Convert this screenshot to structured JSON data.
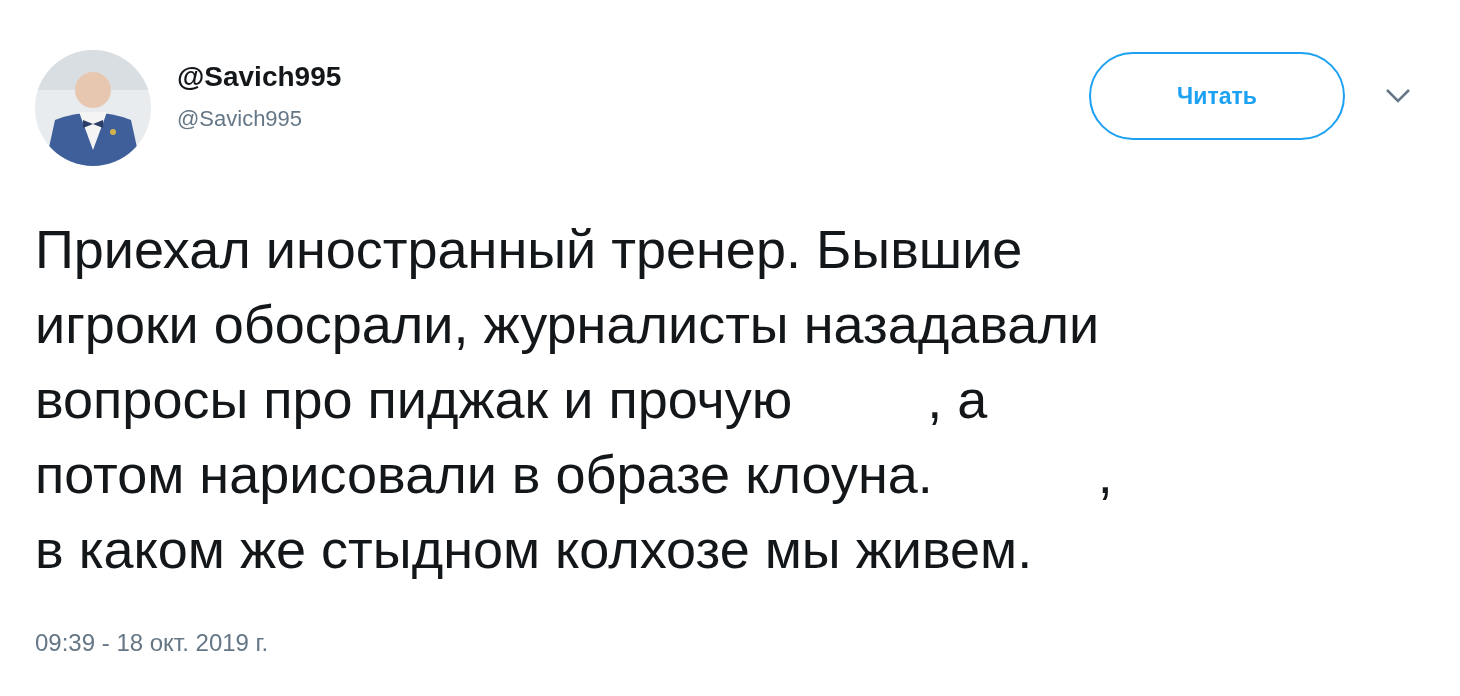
{
  "author": {
    "name": "@Savich995",
    "handle": "@Savich995"
  },
  "follow_button": {
    "label": "Читать"
  },
  "tweet": {
    "text": "Приехал иностранный тренер. Бывшие\nигроки обосрали, журналисты назадавали\nвопросы про пиджак и прочую         , а\nпотом нарисовали в образе клоуна.           ,\nв каком же стыдном колхозе мы живем.",
    "timestamp": "09:39 - 18 окт. 2019 г."
  }
}
